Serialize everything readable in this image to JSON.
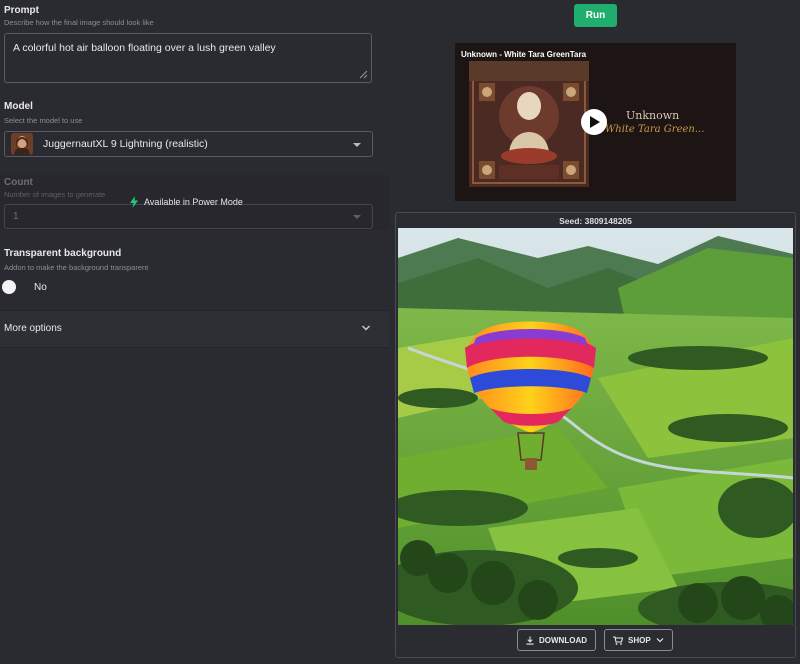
{
  "prompt": {
    "title": "Prompt",
    "subtitle": "Describe how the final image should look like",
    "value": "A colorful hot air balloon floating over a lush green valley"
  },
  "model": {
    "title": "Model",
    "subtitle": "Select the model to use",
    "selected": "JuggernautXL 9 Lightning (realistic)",
    "thumbnail_icon": "portrait-thumbnail"
  },
  "count": {
    "title": "Count",
    "subtitle": "Number of images to generate",
    "value": "1",
    "lock_message": "Available in Power Mode",
    "lock_icon": "lightning-bolt-icon"
  },
  "transparent_background": {
    "title": "Transparent background",
    "subtitle": "Addon to make the background transparent",
    "toggle_state": "off",
    "toggle_label": "No"
  },
  "more_options": {
    "label": "More options"
  },
  "actions": {
    "run_label": "Run",
    "run_color": "#1fae6d"
  },
  "video": {
    "title": "Unknown - White Tara GreenTara",
    "overlay_line1": "Unknown",
    "overlay_line2": "White Tara Green..."
  },
  "result": {
    "seed_label": "Seed: 3809148205",
    "download_label": "DOWNLOAD",
    "shop_label": "SHOP"
  }
}
